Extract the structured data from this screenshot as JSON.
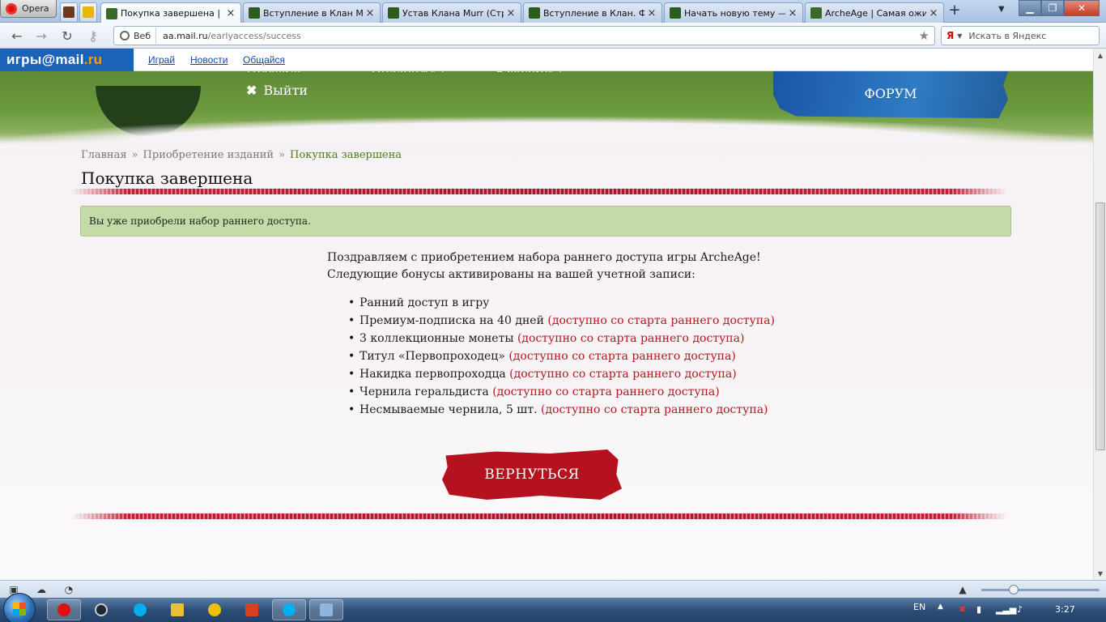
{
  "browser": {
    "menu_label": "Opera",
    "tabs": [
      {
        "label": "Покупка завершена | ...",
        "icon_color": "#3a6a2a",
        "active": true
      },
      {
        "label": "Вступление в Клан М...",
        "icon_color": "#2a5c1e",
        "active": false
      },
      {
        "label": "Устав Клана Murr (Стр...",
        "icon_color": "#2a5c1e",
        "active": false
      },
      {
        "label": "Вступление в Клан. Ф...",
        "icon_color": "#2a5c1e",
        "active": false
      },
      {
        "label": "Начать новую тему —...",
        "icon_color": "#2a5c1e",
        "active": false
      },
      {
        "label": "ArcheAge | Самая ожи...",
        "icon_color": "#3a6a2a",
        "active": false
      }
    ],
    "new_tab": "+",
    "address": {
      "badge": "Веб",
      "host": "aa.mail.ru",
      "path": "/earlyaccess/success"
    },
    "search_placeholder": "Искать в Яндекс",
    "search_engine": "Я"
  },
  "site": {
    "logo_main": "игры@mail",
    "logo_suffix": ".ru",
    "top_links": [
      "Играй",
      "Новости",
      "Общайся"
    ],
    "nav": {
      "exit": "Выйти",
      "profile": "Профиль",
      "support": "Поддержка",
      "showcase": "Ювелирка",
      "forum": "ФОРУМ"
    },
    "breadcrumb": [
      "Главная",
      "Приобретение изданий",
      "Покупка завершена"
    ],
    "breadcrumb_sep": "»",
    "title": "Покупка завершена",
    "notice": "Вы уже приобрели набор раннего доступа.",
    "intro_line1": "Поздравляем с приобретением набора раннего доступа игры ArcheAge!",
    "intro_line2": "Следующие бонусы активированы на вашей учетной записи:",
    "bonuses": [
      {
        "text": "Ранний доступ в игру",
        "note": ""
      },
      {
        "text": "Премиум-подписка на 40 дней",
        "note": "(доступно со старта раннего доступа)"
      },
      {
        "text": "3 коллекционные монеты",
        "note": "(доступно со старта раннего доступа)"
      },
      {
        "text": "Титул «Первопроходец»",
        "note": "(доступно со старта раннего доступа)"
      },
      {
        "text": "Накидка первопроходца",
        "note": "(доступно со старта раннего доступа)"
      },
      {
        "text": "Чернила геральдиста",
        "note": "(доступно со старта раннего доступа)"
      },
      {
        "text": "Несмываемые чернила, 5 шт.",
        "note": "(доступно со старта раннего доступа)"
      }
    ],
    "return_button": "ВЕРНУТЬСЯ"
  },
  "taskbar": {
    "lang": "EN",
    "time": "3:27"
  },
  "colors": {
    "accent_red": "#b5121f",
    "note_red": "#b5161e",
    "notice_green": "#c4dba7",
    "link_blue": "#1844a7",
    "logo_blue": "#1b63b8",
    "logo_orange": "#ff9e00"
  }
}
